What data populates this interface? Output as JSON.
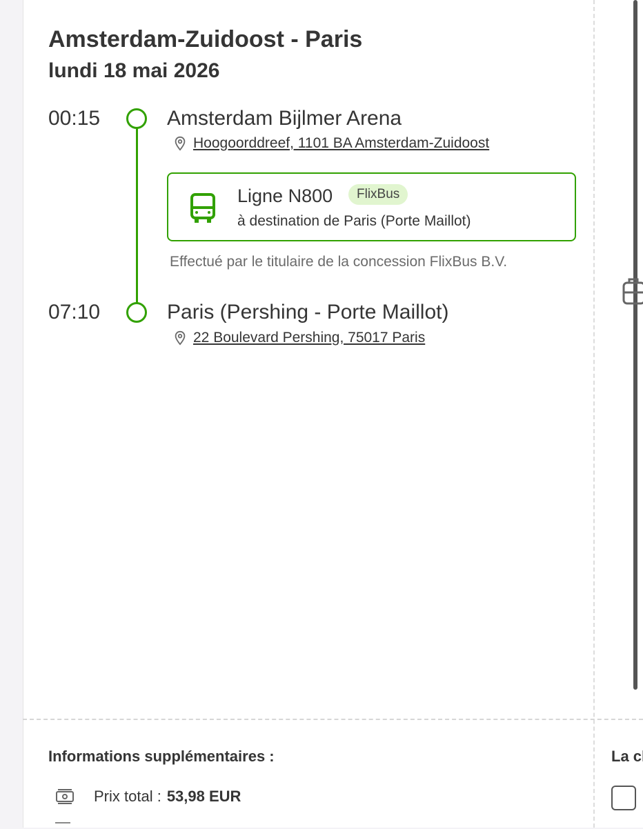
{
  "trip": {
    "title": "Amsterdam-Zuidoost - Paris",
    "date": "lundi 18 mai 2026"
  },
  "departure": {
    "time": "00:15",
    "stop": "Amsterdam Bijlmer Arena",
    "address": "Hoogoorddreef, 1101 BA Amsterdam-Zuidoost"
  },
  "line": {
    "name": "Ligne N800",
    "brand": "FlixBus",
    "destination": "à destination de Paris (Porte Maillot)",
    "operated_by": "Effectué par le titulaire de la concession FlixBus B.V."
  },
  "arrival": {
    "time": "07:10",
    "stop": "Paris (Pershing - Porte Maillot)",
    "address": "22 Boulevard Pershing, 75017 Paris"
  },
  "info": {
    "title": "Informations supplémentaires :",
    "price_label": "Prix total :",
    "price_value": "53,98 EUR"
  },
  "right_column": {
    "heading_cut": "La cl"
  },
  "colors": {
    "accent": "#31a100",
    "badge_bg": "#e1f5cf",
    "text": "#353535"
  },
  "icons": [
    "pin-icon",
    "bus-icon",
    "luggage-icon",
    "cash-icon",
    "checkbox"
  ]
}
